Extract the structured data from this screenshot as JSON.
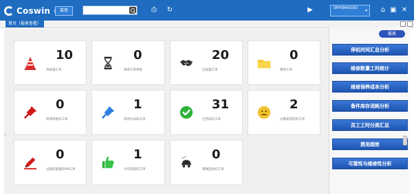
{
  "header": {
    "logo_text": "Coswin",
    "logo_reg": "8i",
    "menu_label": "菜单",
    "search": {
      "placeholder": "",
      "value": ""
    },
    "user": {
      "line1": "SMPSMADD82",
      "line2": ""
    },
    "icons": [
      "print-icon",
      "refresh-icon",
      "user-menu-icon",
      "home-icon",
      "window-icon",
      "close-icon"
    ]
  },
  "tabs": {
    "home_label": "首页（报表查看）"
  },
  "dashboard": {
    "cards": [
      {
        "value": "10",
        "label": "待处理工单",
        "icon": "cone-icon"
      },
      {
        "value": "0",
        "label": "等待工单审批",
        "icon": "hourglass-icon"
      },
      {
        "value": "20",
        "label": "已处理工单",
        "icon": "handshake-icon"
      },
      {
        "value": "0",
        "label": "暂停工单",
        "icon": "folder-icon"
      },
      {
        "value": "0",
        "label": "等待审批的工单",
        "icon": "pin-red-icon"
      },
      {
        "value": "1",
        "label": "等待分派的工单",
        "icon": "pin-blue-icon"
      },
      {
        "value": "31",
        "label": "已完成的工单",
        "icon": "check-icon"
      },
      {
        "value": "2",
        "label": "过期未完成的工单",
        "icon": "neutral-face-icon"
      },
      {
        "value": "0",
        "label": "过期未处理的PM工单",
        "icon": "pen-icon"
      },
      {
        "value": "1",
        "label": "今日完成的工单",
        "icon": "thumbs-up-icon"
      },
      {
        "value": "0",
        "label": "需要回访的工单",
        "icon": "car-icon"
      }
    ]
  },
  "right_panel": {
    "pill_label": "报表",
    "buttons": [
      "停机时间汇总分析",
      "维修数量工时统计",
      "维修保养成本分析",
      "备件库存消耗分析",
      "员工工时分类汇总",
      "费用趋势",
      "可靠性与维修性分析"
    ]
  },
  "colors": {
    "header_blue": "#1f6cc1",
    "panel_button_blue": "#2e5fc6",
    "background_gray": "#f0f0f0"
  }
}
